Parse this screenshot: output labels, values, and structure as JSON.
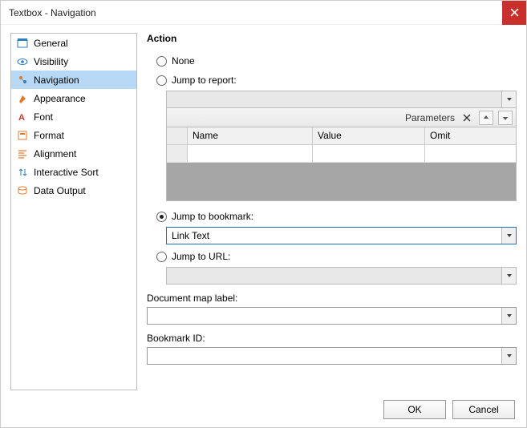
{
  "window": {
    "title": "Textbox - Navigation"
  },
  "sidebar": {
    "items": [
      {
        "label": "General",
        "icon": "general-icon"
      },
      {
        "label": "Visibility",
        "icon": "visibility-icon"
      },
      {
        "label": "Navigation",
        "icon": "navigation-icon",
        "selected": true
      },
      {
        "label": "Appearance",
        "icon": "appearance-icon"
      },
      {
        "label": "Font",
        "icon": "font-icon"
      },
      {
        "label": "Format",
        "icon": "format-icon"
      },
      {
        "label": "Alignment",
        "icon": "alignment-icon"
      },
      {
        "label": "Interactive Sort",
        "icon": "interactive-sort-icon"
      },
      {
        "label": "Data Output",
        "icon": "data-output-icon"
      }
    ]
  },
  "main": {
    "section_title": "Action",
    "radios": {
      "none": "None",
      "jump_report": "Jump to report:",
      "jump_bookmark": "Jump to bookmark:",
      "jump_url": "Jump to URL:"
    },
    "jump_report": {
      "value": "",
      "params_label": "Parameters",
      "columns": {
        "name": "Name",
        "value": "Value",
        "omit": "Omit"
      },
      "rows": [
        {
          "name": "",
          "value": "",
          "omit": ""
        }
      ]
    },
    "jump_bookmark": {
      "value": "Link Text"
    },
    "jump_url": {
      "value": ""
    },
    "doc_map": {
      "label": "Document map label:",
      "value": ""
    },
    "bookmark_id": {
      "label": "Bookmark ID:",
      "value": ""
    }
  },
  "footer": {
    "ok": "OK",
    "cancel": "Cancel"
  },
  "colors": {
    "selected_bg": "#b7d9f5",
    "close_bg": "#c9302c",
    "active_border": "#1e6fbf"
  }
}
